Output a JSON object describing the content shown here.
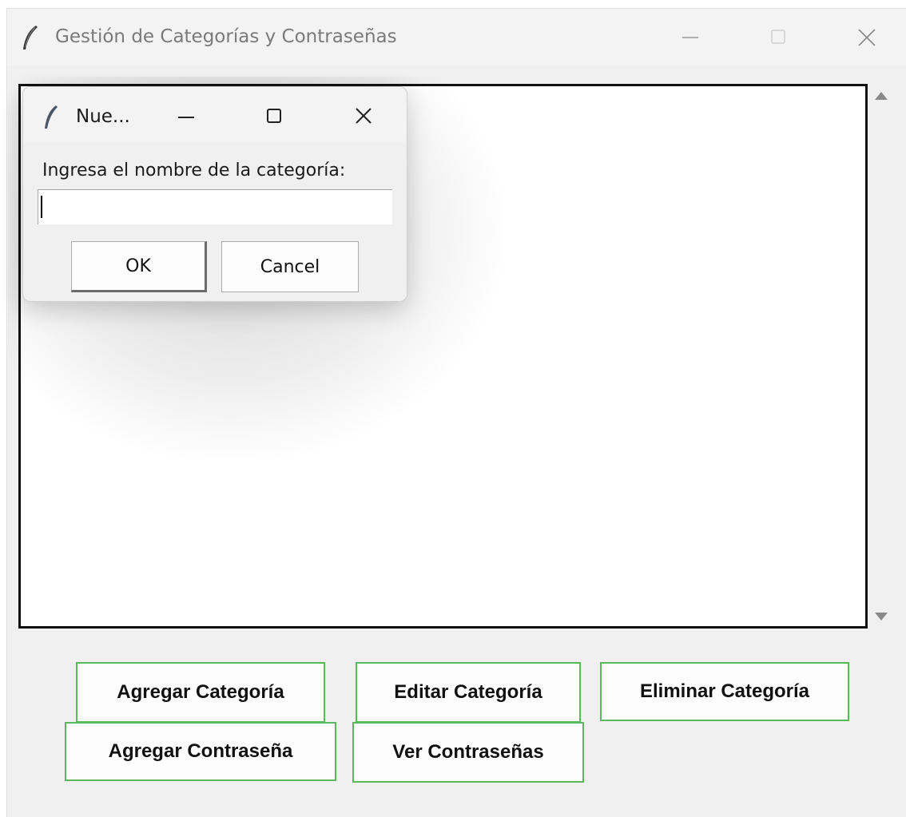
{
  "main_window": {
    "title": "Gestión de Categorías y Contraseñas",
    "controls": {
      "minimize": "minimize-icon",
      "maximize": "maximize-icon",
      "close": "close-icon"
    }
  },
  "listbox": {
    "items": []
  },
  "buttons": {
    "agregar_categoria": "Agregar Categoría",
    "editar_categoria": "Editar Categoría",
    "eliminar_categoria": "Eliminar Categoría",
    "agregar_contrasena": "Agregar Contraseña",
    "ver_contrasenas": "Ver Contraseñas",
    "border_color": "#5cb85c"
  },
  "dialog": {
    "title": "Nue...",
    "prompt": "Ingresa el nombre de la categoría:",
    "input_value": "",
    "ok_label": "OK",
    "cancel_label": "Cancel"
  }
}
